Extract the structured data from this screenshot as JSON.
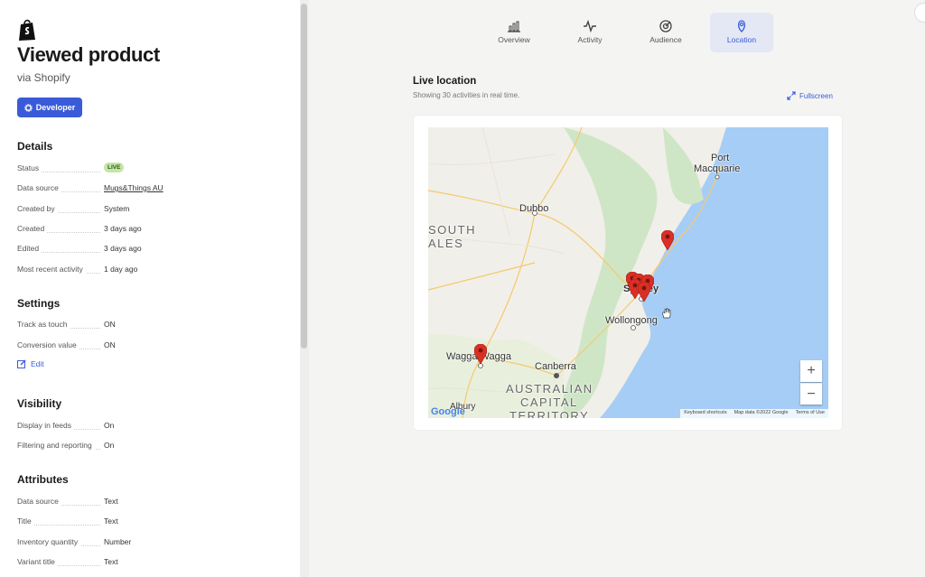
{
  "header": {
    "title": "Viewed product",
    "subtitle": "via Shopify",
    "developer_label": "Developer"
  },
  "details": {
    "heading": "Details",
    "rows": [
      {
        "label": "Status",
        "value": "LIVE"
      },
      {
        "label": "Data source",
        "value": "Mugs&Things AU"
      },
      {
        "label": "Created by",
        "value": "System"
      },
      {
        "label": "Created",
        "value": "3 days ago"
      },
      {
        "label": "Edited",
        "value": "3 days ago"
      },
      {
        "label": "Most recent activity",
        "value": "1 day ago"
      }
    ]
  },
  "settings": {
    "heading": "Settings",
    "rows": [
      {
        "label": "Track as touch",
        "value": "ON"
      },
      {
        "label": "Conversion value",
        "value": "ON"
      }
    ],
    "edit_label": "Edit"
  },
  "visibility": {
    "heading": "Visibility",
    "rows": [
      {
        "label": "Display in feeds",
        "value": "On"
      },
      {
        "label": "Filtering and reporting",
        "value": "On"
      }
    ]
  },
  "attributes": {
    "heading": "Attributes",
    "rows": [
      {
        "label": "Data source",
        "value": "Text"
      },
      {
        "label": "Title",
        "value": "Text"
      },
      {
        "label": "Inventory quantity",
        "value": "Number"
      },
      {
        "label": "Variant title",
        "value": "Text"
      }
    ]
  },
  "tabs": [
    {
      "label": "Overview",
      "icon": "bar-chart-icon"
    },
    {
      "label": "Activity",
      "icon": "pulse-icon"
    },
    {
      "label": "Audience",
      "icon": "target-icon"
    },
    {
      "label": "Location",
      "icon": "location-pin-icon",
      "active": true
    }
  ],
  "live": {
    "title": "Live location",
    "subtitle": "Showing 30 activities in real time.",
    "fullscreen_label": "Fullscreen"
  },
  "map": {
    "labels": {
      "port": "Port",
      "macquarie": "Macquarie",
      "dubbo": "Dubbo",
      "south": "SOUTH",
      "ales": "ALES",
      "sydney": "Sydney",
      "wollongong": "Wollongong",
      "wagga": "Wagga Wagga",
      "canberra": "Canberra",
      "act1": "AUSTRALIAN",
      "act2": "CAPITAL",
      "act3": "TERRITORY",
      "albury": "Albury"
    },
    "zoom_in": "+",
    "zoom_out": "−",
    "footer": [
      "Keyboard shortcuts",
      "Map data ©2022 Google",
      "Terms of Use"
    ],
    "google": "Google"
  },
  "colors": {
    "accent": "#3a5bd9",
    "live_badge": "#c4e5a7",
    "pin": "#d93025",
    "water": "#a6cdf5",
    "land": "#f1efe9",
    "green": "#cfe6c6"
  }
}
